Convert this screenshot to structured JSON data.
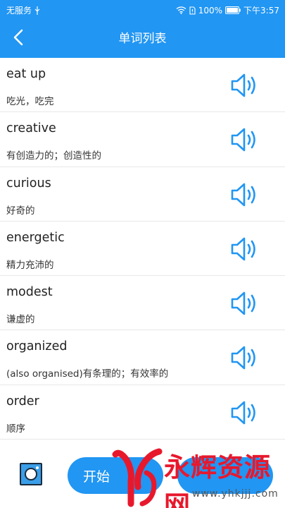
{
  "status_bar": {
    "carrier": "无服务",
    "battery": "100%",
    "time": "下午3:57"
  },
  "header": {
    "title": "单词列表",
    "back_icon": "chevron-left-icon"
  },
  "words": [
    {
      "en": "eat up",
      "cn": "吃光，吃完"
    },
    {
      "en": "creative",
      "cn": "有创造力的；创造性的"
    },
    {
      "en": "curious",
      "cn": "好奇的"
    },
    {
      "en": "energetic",
      "cn": "精力充沛的"
    },
    {
      "en": "modest",
      "cn": "谦虚的"
    },
    {
      "en": "organized",
      "cn": "(also organised)有条理的；有效率的"
    },
    {
      "en": "order",
      "cn": "顺序"
    }
  ],
  "bottom": {
    "start_label": "开始"
  },
  "watermark": {
    "brand": "永辉资源网",
    "url": "www.yhkjjj.com"
  },
  "colors": {
    "primary": "#2196f3",
    "speaker": "#2196f3",
    "watermark": "#e8182c"
  }
}
